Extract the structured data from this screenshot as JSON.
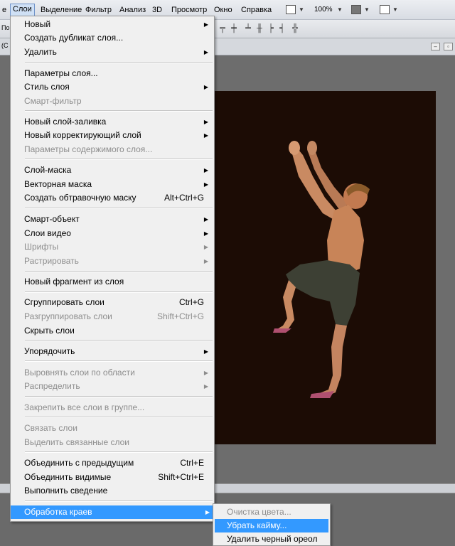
{
  "menubar": {
    "items": [
      "Слои",
      "Выделение",
      "Фильтр",
      "Анализ",
      "3D",
      "Просмотр",
      "Окно",
      "Справка"
    ],
    "zoom": "100%"
  },
  "options_bar": {
    "label": "По"
  },
  "doc_tab": {
    "label": "(С"
  },
  "layer_menu": {
    "items": [
      {
        "label": "Новый",
        "shortcut": "",
        "submenu": true,
        "disabled": false
      },
      {
        "label": "Создать дубликат слоя...",
        "shortcut": "",
        "submenu": false,
        "disabled": false
      },
      {
        "label": "Удалить",
        "shortcut": "",
        "submenu": true,
        "disabled": false
      },
      {
        "label": "Параметры слоя...",
        "shortcut": "",
        "submenu": false,
        "disabled": false
      },
      {
        "label": "Стиль слоя",
        "shortcut": "",
        "submenu": true,
        "disabled": false
      },
      {
        "label": "Смарт-фильтр",
        "shortcut": "",
        "submenu": false,
        "disabled": true
      },
      {
        "label": "Новый слой-заливка",
        "shortcut": "",
        "submenu": true,
        "disabled": false
      },
      {
        "label": "Новый корректирующий слой",
        "shortcut": "",
        "submenu": true,
        "disabled": false
      },
      {
        "label": "Параметры содержимого слоя...",
        "shortcut": "",
        "submenu": false,
        "disabled": true
      },
      {
        "label": "Слой-маска",
        "shortcut": "",
        "submenu": true,
        "disabled": false
      },
      {
        "label": "Векторная маска",
        "shortcut": "",
        "submenu": true,
        "disabled": false
      },
      {
        "label": "Создать обтравочную маску",
        "shortcut": "Alt+Ctrl+G",
        "submenu": false,
        "disabled": false
      },
      {
        "label": "Смарт-объект",
        "shortcut": "",
        "submenu": true,
        "disabled": false
      },
      {
        "label": "Слои видео",
        "shortcut": "",
        "submenu": true,
        "disabled": false
      },
      {
        "label": "Шрифты",
        "shortcut": "",
        "submenu": true,
        "disabled": true
      },
      {
        "label": "Растрировать",
        "shortcut": "",
        "submenu": true,
        "disabled": true
      },
      {
        "label": "Новый фрагмент из слоя",
        "shortcut": "",
        "submenu": false,
        "disabled": false
      },
      {
        "label": "Сгруппировать слои",
        "shortcut": "Ctrl+G",
        "submenu": false,
        "disabled": false
      },
      {
        "label": "Разгруппировать слои",
        "shortcut": "Shift+Ctrl+G",
        "submenu": false,
        "disabled": true
      },
      {
        "label": "Скрыть слои",
        "shortcut": "",
        "submenu": false,
        "disabled": false
      },
      {
        "label": "Упорядочить",
        "shortcut": "",
        "submenu": true,
        "disabled": false
      },
      {
        "label": "Выровнять слои по области",
        "shortcut": "",
        "submenu": true,
        "disabled": true
      },
      {
        "label": "Распределить",
        "shortcut": "",
        "submenu": true,
        "disabled": true
      },
      {
        "label": "Закрепить все слои в группе...",
        "shortcut": "",
        "submenu": false,
        "disabled": true
      },
      {
        "label": "Связать слои",
        "shortcut": "",
        "submenu": false,
        "disabled": true
      },
      {
        "label": "Выделить связанные слои",
        "shortcut": "",
        "submenu": false,
        "disabled": true
      },
      {
        "label": "Объединить с предыдущим",
        "shortcut": "Ctrl+E",
        "submenu": false,
        "disabled": false
      },
      {
        "label": "Объединить видимые",
        "shortcut": "Shift+Ctrl+E",
        "submenu": false,
        "disabled": false
      },
      {
        "label": "Выполнить сведение",
        "shortcut": "",
        "submenu": false,
        "disabled": false
      },
      {
        "label": "Обработка краев",
        "shortcut": "",
        "submenu": true,
        "disabled": false
      }
    ]
  },
  "submenu": {
    "items": [
      {
        "label": "Очистка цвета...",
        "disabled": true
      },
      {
        "label": "Убрать кайму...",
        "disabled": false
      },
      {
        "label": "Удалить черный ореол",
        "disabled": false
      }
    ]
  }
}
